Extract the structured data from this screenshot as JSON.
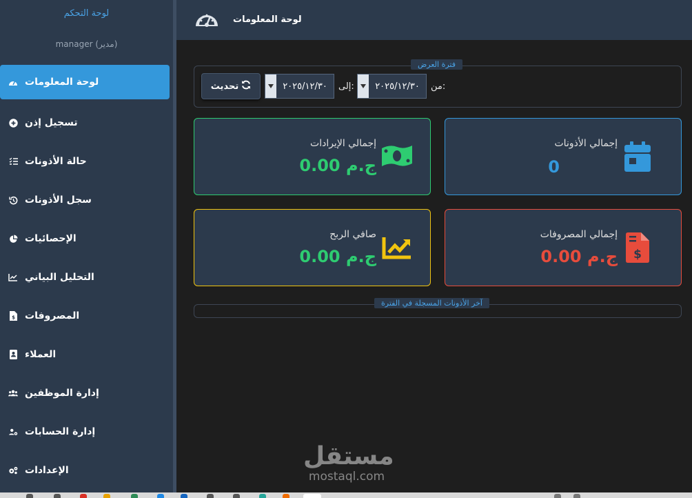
{
  "sidebar": {
    "title": "لوحة التحكم",
    "user": "manager (مدير)",
    "items": [
      {
        "label": "لوحة المعلومات",
        "icon": "dashboard-icon",
        "active": true
      },
      {
        "label": "تسجيل إذن",
        "icon": "plus-circle-icon"
      },
      {
        "label": "حالة الأذونات",
        "icon": "list-check-icon"
      },
      {
        "label": "سجل الأذونات",
        "icon": "history-icon"
      },
      {
        "label": "الإحصائيات",
        "icon": "pie-chart-icon"
      },
      {
        "label": "التحليل البياني",
        "icon": "line-chart-icon"
      },
      {
        "label": "المصروفات",
        "icon": "invoice-icon"
      },
      {
        "label": "العملاء",
        "icon": "address-book-icon"
      },
      {
        "label": "إدارة الموظفين",
        "icon": "users-icon"
      },
      {
        "label": "إدارة الحسابات",
        "icon": "users-cog-icon"
      },
      {
        "label": "الإعدادات",
        "icon": "cogs-icon"
      }
    ]
  },
  "header": {
    "title": "لوحة المعلومات",
    "icon": "gauge-icon"
  },
  "period": {
    "legend": "فترة العرض",
    "from_label": "من:",
    "from_value": "٢٠٢٥/١٢/٣٠",
    "to_label": "إلى:",
    "to_value": "٢٠٢٥/١٢/٣٠",
    "refresh_label": "تحديث",
    "refresh_icon": "sync-icon"
  },
  "cards": {
    "permits": {
      "label": "إجمالي الأذونات",
      "value": "0",
      "color": "#3498db",
      "icon": "calendar-icon"
    },
    "revenue": {
      "label": "إجمالي الإيرادات",
      "value": "0.00 ج.م",
      "color": "#2ecc71",
      "icon": "money-bill-icon"
    },
    "expenses": {
      "label": "إجمالي المصروفات",
      "value": "0.00 ج.م",
      "color": "#e74c3c",
      "icon": "file-invoice-dollar-icon"
    },
    "profit": {
      "label": "صافي الربح",
      "value": "0.00 ج.م",
      "color": "#f1c40f",
      "icon": "chart-line-icon"
    }
  },
  "recent": {
    "legend": "آخر الأذونات المسجلة في الفترة"
  },
  "watermark": {
    "arabic": "مستقل",
    "latin": "mostaql.com"
  }
}
